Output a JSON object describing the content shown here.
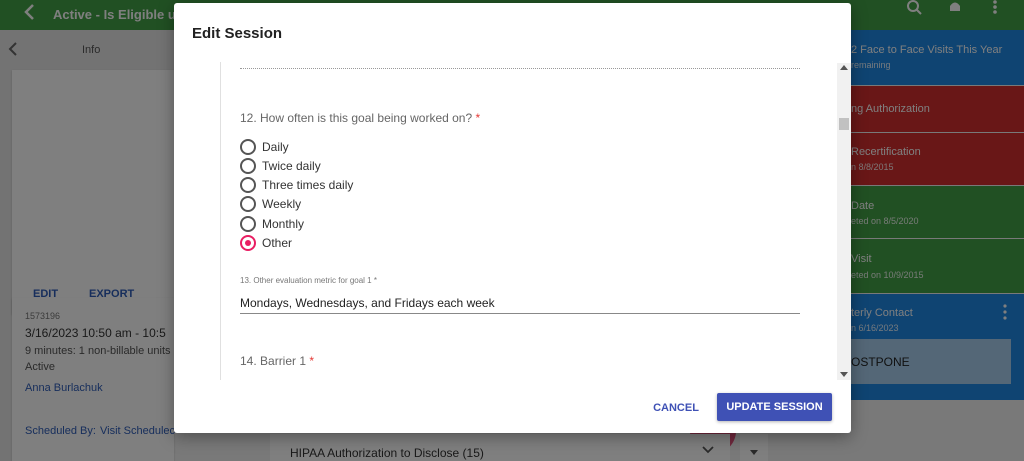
{
  "app": {
    "title": "Active - Is Eligible un",
    "info_label": "Info",
    "edit_label": "EDIT",
    "export_label": "EXPORT",
    "record": {
      "id": "1573196",
      "datetime": "3/16/2023 10:50 am - 10:5",
      "duration": "9 minutes: 1 non-billable units",
      "status": "Active",
      "person": "Anna Burlachuk",
      "scheduled_by_label": "Scheduled By:",
      "scheduled_by_value": "Visit Schedulec"
    },
    "bottom_item": "HIPAA Authorization to Disclose (15)",
    "colors": {
      "green": "#43a047",
      "red": "#d32f2f",
      "blue": "#1e88e5",
      "light_blue": "#a8cfee",
      "pink": "#e0507a"
    }
  },
  "right_panel": {
    "items": [
      {
        "title": "2 Face to Face Visits This Year",
        "sub": "remaining",
        "color": "#1e88e5"
      },
      {
        "title": "ng Authorization",
        "sub": "",
        "color": "#d32f2f"
      },
      {
        "title": "Recertification",
        "sub": "n 8/8/2015",
        "color": "#d32f2f"
      },
      {
        "title": "Date",
        "sub": "eted on 8/5/2020",
        "color": "#43a047"
      },
      {
        "title": "Visit",
        "sub": "eted on 10/9/2015",
        "color": "#43a047"
      },
      {
        "title": "terly Contact",
        "sub": "n 6/16/2023",
        "color": "#1e88e5"
      }
    ],
    "postpone_label": "OSTPONE"
  },
  "dialog": {
    "title": "Edit Session",
    "q12": {
      "label": "12. How often is this goal being worked on?",
      "required": "*"
    },
    "options": [
      "Daily",
      "Twice daily",
      "Three times daily",
      "Weekly",
      "Monthly",
      "Other"
    ],
    "selected": "Other",
    "q13": {
      "label": "13. Other evaluation metric for goal 1 *",
      "value": "Mondays, Wednesdays, and Fridays each week"
    },
    "q14": {
      "label": "14. Barrier 1",
      "required": "*"
    },
    "cancel_label": "CANCEL",
    "update_label": "UPDATE SESSION"
  }
}
